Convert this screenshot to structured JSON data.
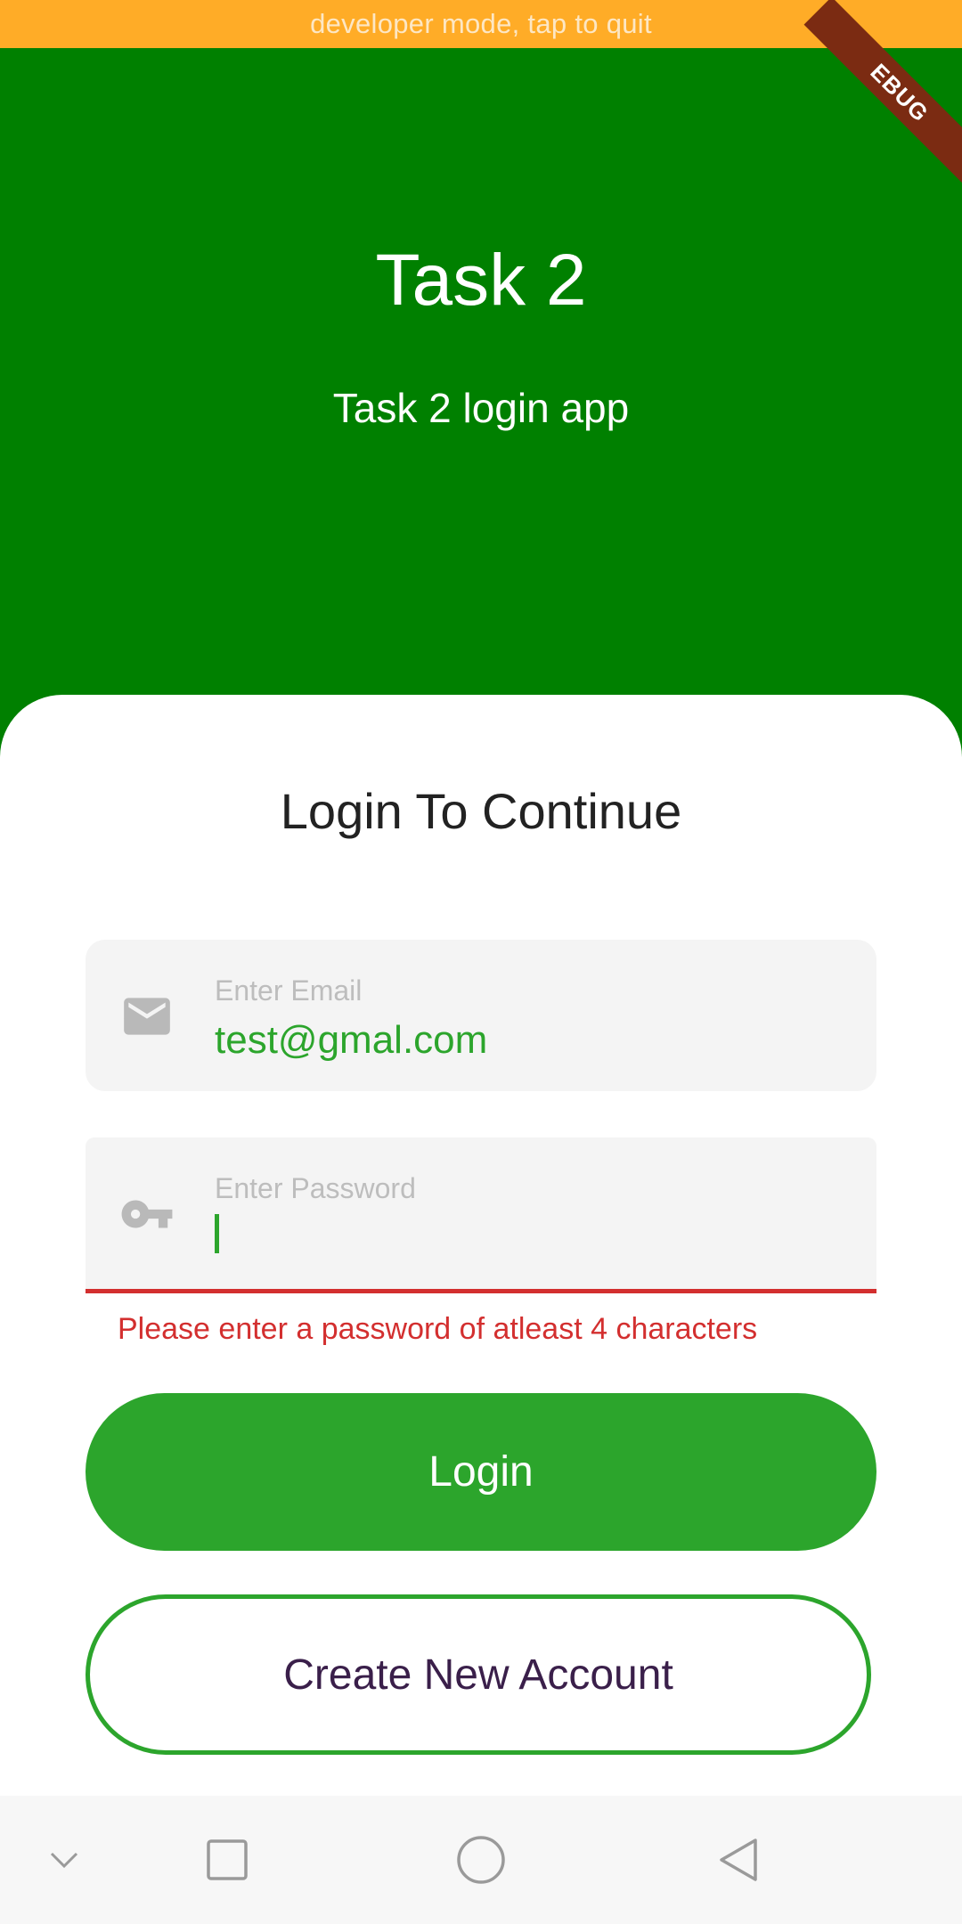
{
  "dev_banner": {
    "text": "developer mode, tap to quit",
    "color": "#FFAC27"
  },
  "debug_ribbon": {
    "text": "EBUG"
  },
  "header": {
    "title": "Task 2",
    "subtitle": "Task 2 login app",
    "color": "#008000"
  },
  "login_card": {
    "title": "Login To Continue",
    "email_field": {
      "label": "Enter Email",
      "value": "test@gmal.com",
      "icon": "mail-icon"
    },
    "password_field": {
      "label": "Enter Password",
      "value": "",
      "icon": "key-icon",
      "error": "Please enter a password of atleast 4 characters"
    },
    "login_button": "Login",
    "create_account_button": "Create New Account",
    "accent_color": "#2CA52C",
    "error_color": "#D32F2F"
  },
  "navigation_bar": {
    "buttons": [
      "chevron-down-icon",
      "recents-square-icon",
      "home-circle-icon",
      "back-triangle-icon"
    ]
  }
}
